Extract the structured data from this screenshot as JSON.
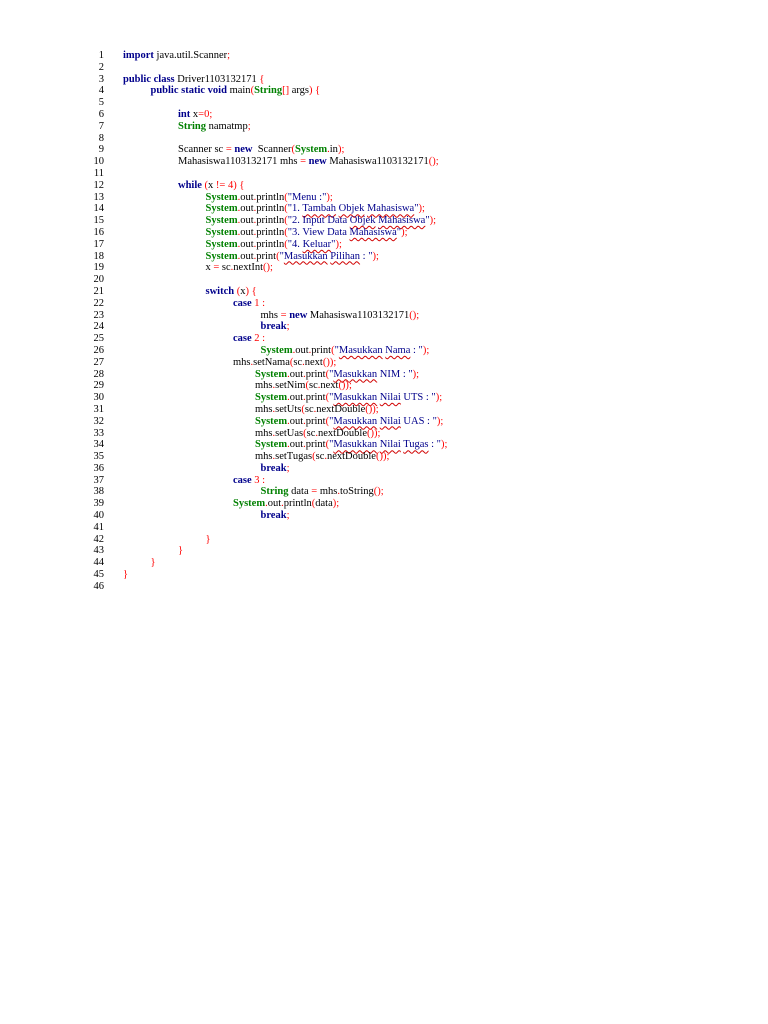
{
  "colors": {
    "keyword": "#00008b",
    "type": "#008000",
    "operator": "#ff0000",
    "string": "#00008b",
    "line_number": "#000000",
    "spellcheck_squiggle": "#d00000"
  },
  "lines": [
    {
      "n": "1",
      "indent": 0,
      "segs": [
        [
          "kw",
          "import"
        ],
        [
          "plain",
          " java.util.Scanner"
        ],
        [
          "op",
          ";"
        ]
      ]
    },
    {
      "n": "2",
      "indent": 0,
      "segs": []
    },
    {
      "n": "3",
      "indent": 0,
      "segs": [
        [
          "kw",
          "public class"
        ],
        [
          "plain",
          " Driver1103132171 "
        ],
        [
          "op",
          "{"
        ]
      ]
    },
    {
      "n": "4",
      "indent": 1,
      "segs": [
        [
          "kw",
          "public static void"
        ],
        [
          "plain",
          " main"
        ],
        [
          "op",
          "("
        ],
        [
          "ty",
          "String"
        ],
        [
          "op",
          "[]"
        ],
        [
          "plain",
          " args"
        ],
        [
          "op",
          ")"
        ],
        [
          "plain",
          " "
        ],
        [
          "op",
          "{"
        ]
      ]
    },
    {
      "n": "5",
      "indent": 0,
      "segs": []
    },
    {
      "n": "6",
      "indent": 2,
      "segs": [
        [
          "kw",
          "int"
        ],
        [
          "plain",
          " x"
        ],
        [
          "op",
          "="
        ],
        [
          "num",
          "0"
        ],
        [
          "op",
          ";"
        ]
      ]
    },
    {
      "n": "7",
      "indent": 2,
      "segs": [
        [
          "ty",
          "String"
        ],
        [
          "plain",
          " namatmp"
        ],
        [
          "op",
          ";"
        ]
      ]
    },
    {
      "n": "8",
      "indent": 0,
      "segs": []
    },
    {
      "n": "9",
      "indent": 2,
      "segs": [
        [
          "plain",
          "Scanner sc "
        ],
        [
          "op",
          "="
        ],
        [
          "plain",
          " "
        ],
        [
          "kw",
          "new"
        ],
        [
          "plain",
          "  Scanner"
        ],
        [
          "op",
          "("
        ],
        [
          "sys",
          "System"
        ],
        [
          "op",
          "."
        ],
        [
          "plain",
          "in"
        ],
        [
          "op",
          ")"
        ],
        [
          "op",
          ";"
        ]
      ]
    },
    {
      "n": "10",
      "indent": 2,
      "segs": [
        [
          "plain",
          "Mahasiswa1103132171 mhs "
        ],
        [
          "op",
          "="
        ],
        [
          "plain",
          " "
        ],
        [
          "kw",
          "new"
        ],
        [
          "plain",
          " Mahasiswa1103132171"
        ],
        [
          "op",
          "()"
        ],
        [
          "op",
          ";"
        ]
      ]
    },
    {
      "n": "11",
      "indent": 0,
      "segs": []
    },
    {
      "n": "12",
      "indent": 2,
      "segs": [
        [
          "kw",
          "while"
        ],
        [
          "plain",
          " "
        ],
        [
          "op",
          "("
        ],
        [
          "plain",
          "x "
        ],
        [
          "op",
          "!="
        ],
        [
          "plain",
          " "
        ],
        [
          "num",
          "4"
        ],
        [
          "op",
          ")"
        ],
        [
          "plain",
          " "
        ],
        [
          "op",
          "{"
        ]
      ]
    },
    {
      "n": "13",
      "indent": 3,
      "segs": [
        [
          "sys",
          "System"
        ],
        [
          "op",
          "."
        ],
        [
          "plain",
          "out"
        ],
        [
          "op",
          "."
        ],
        [
          "plain",
          "println"
        ],
        [
          "op",
          "("
        ],
        [
          "str",
          "\"Menu :\""
        ],
        [
          "op",
          ")"
        ],
        [
          "op",
          ";"
        ]
      ]
    },
    {
      "n": "14",
      "indent": 3,
      "segs": [
        [
          "sys",
          "System"
        ],
        [
          "op",
          "."
        ],
        [
          "plain",
          "out"
        ],
        [
          "op",
          "."
        ],
        [
          "plain",
          "println"
        ],
        [
          "op",
          "("
        ],
        [
          "str",
          "\"1. "
        ],
        [
          "str sq",
          "Tambah"
        ],
        [
          "str",
          " "
        ],
        [
          "str sq",
          "Objek"
        ],
        [
          "str",
          " "
        ],
        [
          "str sq",
          "Mahasiswa"
        ],
        [
          "str",
          "\""
        ],
        [
          "op",
          ")"
        ],
        [
          "op",
          ";"
        ]
      ]
    },
    {
      "n": "15",
      "indent": 3,
      "segs": [
        [
          "sys",
          "System"
        ],
        [
          "op",
          "."
        ],
        [
          "plain",
          "out"
        ],
        [
          "op",
          "."
        ],
        [
          "plain",
          "println"
        ],
        [
          "op",
          "("
        ],
        [
          "str",
          "\"2. Input Data "
        ],
        [
          "str sq",
          "Objek"
        ],
        [
          "str",
          " "
        ],
        [
          "str sq",
          "Mahasiswa"
        ],
        [
          "str",
          "\""
        ],
        [
          "op",
          ")"
        ],
        [
          "op",
          ";"
        ]
      ]
    },
    {
      "n": "16",
      "indent": 3,
      "segs": [
        [
          "sys",
          "System"
        ],
        [
          "op",
          "."
        ],
        [
          "plain",
          "out"
        ],
        [
          "op",
          "."
        ],
        [
          "plain",
          "println"
        ],
        [
          "op",
          "("
        ],
        [
          "str",
          "\"3. View Data "
        ],
        [
          "str sq",
          "Mahasiswa"
        ],
        [
          "str",
          "\""
        ],
        [
          "op",
          ")"
        ],
        [
          "op",
          ";"
        ]
      ]
    },
    {
      "n": "17",
      "indent": 3,
      "segs": [
        [
          "sys",
          "System"
        ],
        [
          "op",
          "."
        ],
        [
          "plain",
          "out"
        ],
        [
          "op",
          "."
        ],
        [
          "plain",
          "println"
        ],
        [
          "op",
          "("
        ],
        [
          "str",
          "\"4. "
        ],
        [
          "str sq",
          "Keluar"
        ],
        [
          "str",
          "\""
        ],
        [
          "op",
          ")"
        ],
        [
          "op",
          ";"
        ]
      ]
    },
    {
      "n": "18",
      "indent": 3,
      "segs": [
        [
          "sys",
          "System"
        ],
        [
          "op",
          "."
        ],
        [
          "plain",
          "out"
        ],
        [
          "op",
          "."
        ],
        [
          "plain",
          "print"
        ],
        [
          "op",
          "("
        ],
        [
          "str",
          "\""
        ],
        [
          "str sq",
          "Masukkan"
        ],
        [
          "str",
          " "
        ],
        [
          "str sq",
          "Pilihan"
        ],
        [
          "str",
          " : \""
        ],
        [
          "op",
          ")"
        ],
        [
          "op",
          ";"
        ]
      ]
    },
    {
      "n": "19",
      "indent": 3,
      "segs": [
        [
          "plain",
          "x "
        ],
        [
          "op",
          "="
        ],
        [
          "plain",
          " sc"
        ],
        [
          "op",
          "."
        ],
        [
          "plain",
          "nextInt"
        ],
        [
          "op",
          "()"
        ],
        [
          "op",
          ";"
        ]
      ]
    },
    {
      "n": "20",
      "indent": 0,
      "segs": []
    },
    {
      "n": "21",
      "indent": 3,
      "segs": [
        [
          "kw",
          "switch"
        ],
        [
          "plain",
          " "
        ],
        [
          "op",
          "("
        ],
        [
          "plain",
          "x"
        ],
        [
          "op",
          ")"
        ],
        [
          "plain",
          " "
        ],
        [
          "op",
          "{"
        ]
      ]
    },
    {
      "n": "22",
      "indent": 4,
      "segs": [
        [
          "kw",
          "case"
        ],
        [
          "plain",
          " "
        ],
        [
          "num",
          "1"
        ],
        [
          "plain",
          " "
        ],
        [
          "op",
          ":"
        ]
      ]
    },
    {
      "n": "23",
      "indent": 5,
      "segs": [
        [
          "plain",
          "mhs "
        ],
        [
          "op",
          "="
        ],
        [
          "plain",
          " "
        ],
        [
          "kw",
          "new"
        ],
        [
          "plain",
          " Mahasiswa1103132171"
        ],
        [
          "op",
          "()"
        ],
        [
          "op",
          ";"
        ]
      ]
    },
    {
      "n": "24",
      "indent": 5,
      "segs": [
        [
          "kw",
          "break"
        ],
        [
          "op",
          ";"
        ]
      ]
    },
    {
      "n": "25",
      "indent": 4,
      "segs": [
        [
          "kw",
          "case"
        ],
        [
          "plain",
          " "
        ],
        [
          "num",
          "2"
        ],
        [
          "plain",
          " "
        ],
        [
          "op",
          ":"
        ]
      ]
    },
    {
      "n": "26",
      "indent": 5,
      "segs": [
        [
          "sys",
          "System"
        ],
        [
          "op",
          "."
        ],
        [
          "plain",
          "out"
        ],
        [
          "op",
          "."
        ],
        [
          "plain",
          "print"
        ],
        [
          "op",
          "("
        ],
        [
          "str",
          "\""
        ],
        [
          "str sq",
          "Masukkan"
        ],
        [
          "str",
          " "
        ],
        [
          "str sq",
          "Nama"
        ],
        [
          "str",
          " : \""
        ],
        [
          "op",
          ")"
        ],
        [
          "op",
          ";"
        ]
      ]
    },
    {
      "n": "27",
      "indent": 4,
      "segs": [
        [
          "plain",
          "mhs"
        ],
        [
          "op",
          "."
        ],
        [
          "plain",
          "setNama"
        ],
        [
          "op",
          "("
        ],
        [
          "plain",
          "sc"
        ],
        [
          "op",
          "."
        ],
        [
          "plain",
          "next"
        ],
        [
          "op",
          "())"
        ],
        [
          "op",
          ";"
        ]
      ]
    },
    {
      "n": "28",
      "indent": 4.8,
      "segs": [
        [
          "sys",
          "System"
        ],
        [
          "op",
          "."
        ],
        [
          "plain",
          "out"
        ],
        [
          "op",
          "."
        ],
        [
          "plain",
          "print"
        ],
        [
          "op",
          "("
        ],
        [
          "str",
          "\""
        ],
        [
          "str sq",
          "Masukkan"
        ],
        [
          "str",
          " NIM : \""
        ],
        [
          "op",
          ")"
        ],
        [
          "op",
          ";"
        ]
      ]
    },
    {
      "n": "29",
      "indent": 4.8,
      "segs": [
        [
          "plain",
          "mhs"
        ],
        [
          "op",
          "."
        ],
        [
          "plain",
          "setNim"
        ],
        [
          "op",
          "("
        ],
        [
          "plain",
          "sc"
        ],
        [
          "op",
          "."
        ],
        [
          "plain",
          "next"
        ],
        [
          "op",
          "())"
        ],
        [
          "op",
          ";"
        ]
      ]
    },
    {
      "n": "30",
      "indent": 4.8,
      "segs": [
        [
          "sys",
          "System"
        ],
        [
          "op",
          "."
        ],
        [
          "plain",
          "out"
        ],
        [
          "op",
          "."
        ],
        [
          "plain",
          "print"
        ],
        [
          "op",
          "("
        ],
        [
          "str",
          "\""
        ],
        [
          "str sq",
          "Masukkan"
        ],
        [
          "str",
          " "
        ],
        [
          "str sq",
          "Nilai"
        ],
        [
          "str",
          " UTS : \""
        ],
        [
          "op",
          ")"
        ],
        [
          "op",
          ";"
        ]
      ]
    },
    {
      "n": "31",
      "indent": 4.8,
      "segs": [
        [
          "plain",
          "mhs"
        ],
        [
          "op",
          "."
        ],
        [
          "plain",
          "setUts"
        ],
        [
          "op",
          "("
        ],
        [
          "plain",
          "sc"
        ],
        [
          "op",
          "."
        ],
        [
          "plain",
          "nextDouble"
        ],
        [
          "op",
          "())"
        ],
        [
          "op",
          ";"
        ]
      ]
    },
    {
      "n": "32",
      "indent": 4.8,
      "segs": [
        [
          "sys",
          "System"
        ],
        [
          "op",
          "."
        ],
        [
          "plain",
          "out"
        ],
        [
          "op",
          "."
        ],
        [
          "plain",
          "print"
        ],
        [
          "op",
          "("
        ],
        [
          "str",
          "\""
        ],
        [
          "str sq",
          "Masukkan"
        ],
        [
          "str",
          " "
        ],
        [
          "str sq",
          "Nilai"
        ],
        [
          "str",
          " UAS : \""
        ],
        [
          "op",
          ")"
        ],
        [
          "op",
          ";"
        ]
      ]
    },
    {
      "n": "33",
      "indent": 4.8,
      "segs": [
        [
          "plain",
          "mhs"
        ],
        [
          "op",
          "."
        ],
        [
          "plain",
          "setUas"
        ],
        [
          "op",
          "("
        ],
        [
          "plain",
          "sc"
        ],
        [
          "op",
          "."
        ],
        [
          "plain",
          "nextDouble"
        ],
        [
          "op",
          "())"
        ],
        [
          "op",
          ";"
        ]
      ]
    },
    {
      "n": "34",
      "indent": 4.8,
      "segs": [
        [
          "sys",
          "System"
        ],
        [
          "op",
          "."
        ],
        [
          "plain",
          "out"
        ],
        [
          "op",
          "."
        ],
        [
          "plain",
          "print"
        ],
        [
          "op",
          "("
        ],
        [
          "str",
          "\""
        ],
        [
          "str sq",
          "Masukkan"
        ],
        [
          "str",
          " "
        ],
        [
          "str sq",
          "Nilai"
        ],
        [
          "str",
          " "
        ],
        [
          "str sq",
          "Tugas"
        ],
        [
          "str",
          " : \""
        ],
        [
          "op",
          ")"
        ],
        [
          "op",
          ";"
        ]
      ]
    },
    {
      "n": "35",
      "indent": 4.8,
      "segs": [
        [
          "plain",
          "mhs"
        ],
        [
          "op",
          "."
        ],
        [
          "plain",
          "setTugas"
        ],
        [
          "op",
          "("
        ],
        [
          "plain",
          "sc"
        ],
        [
          "op",
          "."
        ],
        [
          "plain",
          "nextDouble"
        ],
        [
          "op",
          "())"
        ],
        [
          "op",
          ";"
        ]
      ]
    },
    {
      "n": "36",
      "indent": 5,
      "segs": [
        [
          "kw",
          "break"
        ],
        [
          "op",
          ";"
        ]
      ]
    },
    {
      "n": "37",
      "indent": 4,
      "segs": [
        [
          "kw",
          "case"
        ],
        [
          "plain",
          " "
        ],
        [
          "num",
          "3"
        ],
        [
          "plain",
          " "
        ],
        [
          "op",
          ":"
        ]
      ]
    },
    {
      "n": "38",
      "indent": 5,
      "segs": [
        [
          "ty",
          "String"
        ],
        [
          "plain",
          " data "
        ],
        [
          "op",
          "="
        ],
        [
          "plain",
          " mhs"
        ],
        [
          "op",
          "."
        ],
        [
          "plain",
          "toString"
        ],
        [
          "op",
          "()"
        ],
        [
          "op",
          ";"
        ]
      ]
    },
    {
      "n": "39",
      "indent": 4,
      "segs": [
        [
          "sys",
          "System"
        ],
        [
          "op",
          "."
        ],
        [
          "plain",
          "out"
        ],
        [
          "op",
          "."
        ],
        [
          "plain",
          "println"
        ],
        [
          "op",
          "("
        ],
        [
          "plain",
          "data"
        ],
        [
          "op",
          ")"
        ],
        [
          "op",
          ";"
        ]
      ]
    },
    {
      "n": "40",
      "indent": 5,
      "segs": [
        [
          "kw",
          "break"
        ],
        [
          "op",
          ";"
        ]
      ]
    },
    {
      "n": "41",
      "indent": 0,
      "segs": []
    },
    {
      "n": "42",
      "indent": 3,
      "segs": [
        [
          "op",
          "}"
        ]
      ]
    },
    {
      "n": "43",
      "indent": 2,
      "segs": [
        [
          "op",
          "}"
        ]
      ]
    },
    {
      "n": "44",
      "indent": 1,
      "segs": [
        [
          "op",
          "}"
        ]
      ]
    },
    {
      "n": "45",
      "indent": 0,
      "segs": [
        [
          "op",
          "}"
        ]
      ]
    },
    {
      "n": "46",
      "indent": 0,
      "segs": []
    }
  ]
}
